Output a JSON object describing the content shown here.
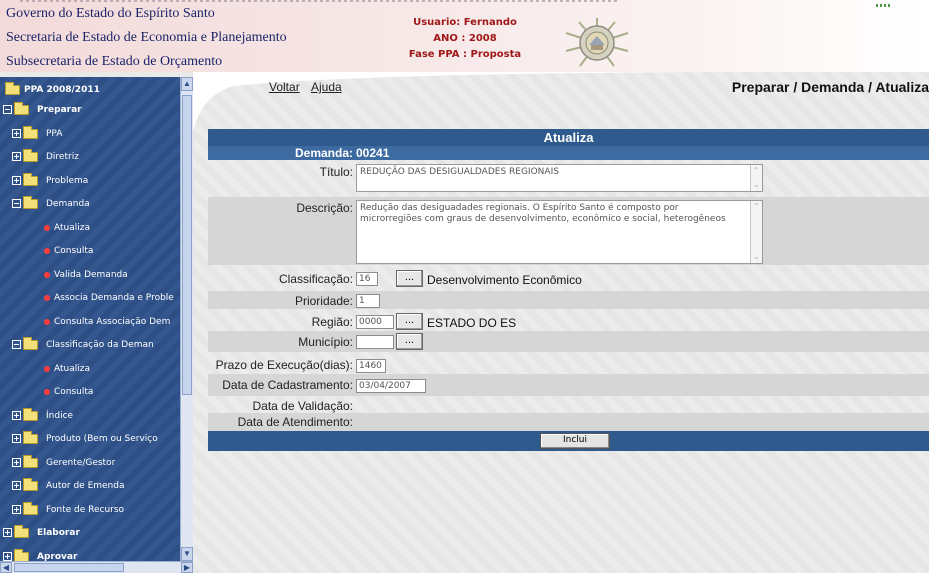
{
  "header": {
    "org_lines": [
      "Governo do Estado do Espírito Santo",
      "Secretaria de Estado de Economia e Planejamento",
      "Subsecretaria de Estado de Orçamento"
    ],
    "usuario": "Usuario: Fernando",
    "ano": "ANO : 2008",
    "fase": "Fase PPA : Proposta"
  },
  "sidebar": {
    "root": "PPA 2008/2011",
    "items": [
      {
        "label": "Preparar",
        "type": "folder-open",
        "level": 1,
        "bold": true
      },
      {
        "label": "PPA",
        "type": "folder",
        "level": 2
      },
      {
        "label": "Diretriz",
        "type": "folder",
        "level": 2
      },
      {
        "label": "Problema",
        "type": "folder",
        "level": 2
      },
      {
        "label": "Demanda",
        "type": "folder-open",
        "level": 2
      },
      {
        "label": "Atualiza",
        "type": "leaf",
        "level": 3
      },
      {
        "label": "Consulta",
        "type": "leaf",
        "level": 3
      },
      {
        "label": "Valida Demanda",
        "type": "leaf",
        "level": 3
      },
      {
        "label": "Associa Demanda e Proble",
        "type": "leaf",
        "level": 3
      },
      {
        "label": "Consulta Associação Dem",
        "type": "leaf",
        "level": 3
      },
      {
        "label": "Classificação da Deman",
        "type": "folder-open",
        "level": 2
      },
      {
        "label": "Atualiza",
        "type": "leaf",
        "level": 3
      },
      {
        "label": "Consulta",
        "type": "leaf",
        "level": 3
      },
      {
        "label": "Índice",
        "type": "folder",
        "level": 2
      },
      {
        "label": "Produto (Bem ou Serviço",
        "type": "folder",
        "level": 2
      },
      {
        "label": "Gerente/Gestor",
        "type": "folder",
        "level": 2
      },
      {
        "label": "Autor de Emenda",
        "type": "folder",
        "level": 2
      },
      {
        "label": "Fonte de Recurso",
        "type": "folder",
        "level": 2
      },
      {
        "label": "Elaborar",
        "type": "folder",
        "level": 1,
        "bold": true
      },
      {
        "label": "Aprovar",
        "type": "folder",
        "level": 1,
        "bold": true
      }
    ]
  },
  "nav": {
    "voltar": "Voltar",
    "ajuda": "Ajuda",
    "breadcrumb": "Preparar / Demanda / Atualiza"
  },
  "form": {
    "title": "Atualiza",
    "demanda_label": "Demanda:",
    "demanda_value": "00241",
    "titulo_label": "Título:",
    "titulo_value": "REDUÇÃO DAS DESIGUALDADES REGIONAIS",
    "descricao_label": "Descrição:",
    "descricao_value": "Redução das desiguadades regionais. O Espírito Santo é composto por microrregiões com graus de desenvolvimento, econômico e social, heterogêneos",
    "classificacao_label": "Classificação:",
    "classificacao_code": "16",
    "classificacao_desc": "Desenvolvimento Econômico",
    "prioridade_label": "Prioridade:",
    "prioridade_value": "1",
    "regiao_label": "Região:",
    "regiao_code": "0000",
    "regiao_desc": "ESTADO DO ES",
    "municipio_label": "Município:",
    "municipio_value": "",
    "prazo_label": "Prazo de Execução(dias):",
    "prazo_value": "1460",
    "cadastramento_label": "Data de Cadastramento:",
    "cadastramento_value": "03/04/2007",
    "validacao_label": "Data de Validação:",
    "atendimento_label": "Data de Atendimento:",
    "dots_label": "...",
    "inclui_label": "Inclui"
  },
  "colors": {
    "sidebar_bg": "#30528a",
    "bar_bg": "#2f5a8e",
    "header_text": "#1a2468",
    "user_text": "#a01818"
  }
}
